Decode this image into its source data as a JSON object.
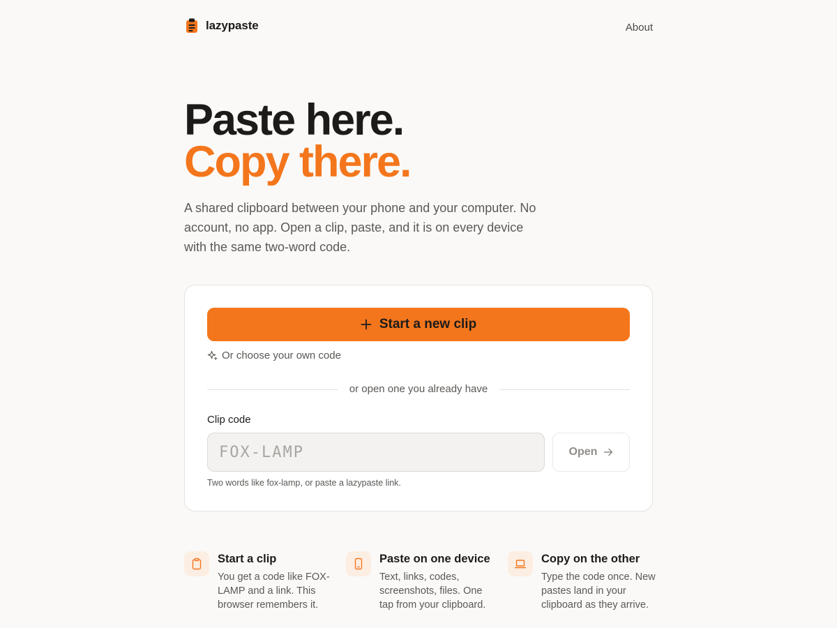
{
  "header": {
    "brand": "lazypaste",
    "brand_icon": "clipboard-logo-icon",
    "about_link": "About"
  },
  "hero": {
    "line1": "Paste here.",
    "line2": "Copy there.",
    "lead": "A shared clipboard between your phone and your computer. No account, no app. Open a clip, paste, and it is on every device with the same two-word code."
  },
  "card": {
    "primary_button": "Start a new clip",
    "primary_icon": "plus-icon",
    "choose_link": "Or choose your own code",
    "choose_icon": "sparkle-icon",
    "divider_text": "or open one you already have",
    "field_label": "Clip code",
    "input_value": "",
    "input_placeholder": "FOX-LAMP",
    "open_button": "Open",
    "open_icon": "arrow-right-icon",
    "hint": "Two words like fox-lamp, or paste a lazypaste link."
  },
  "features": [
    {
      "icon": "clipboard-icon",
      "title": "Start a clip",
      "desc": "You get a code like FOX-LAMP and a link. This browser remembers it."
    },
    {
      "icon": "phone-icon",
      "title": "Paste on one device",
      "desc": "Text, links, codes, screenshots, files. One tap from your clipboard."
    },
    {
      "icon": "laptop-icon",
      "title": "Copy on the other",
      "desc": "Type the code once. New pastes land in your clipboard as they arrive."
    }
  ],
  "colors": {
    "accent": "#f4761c",
    "background": "#faf9f7",
    "card": "#ffffff",
    "text": "#1c1b1a",
    "muted": "#5b5855",
    "icon_tile": "#fdeee3"
  }
}
